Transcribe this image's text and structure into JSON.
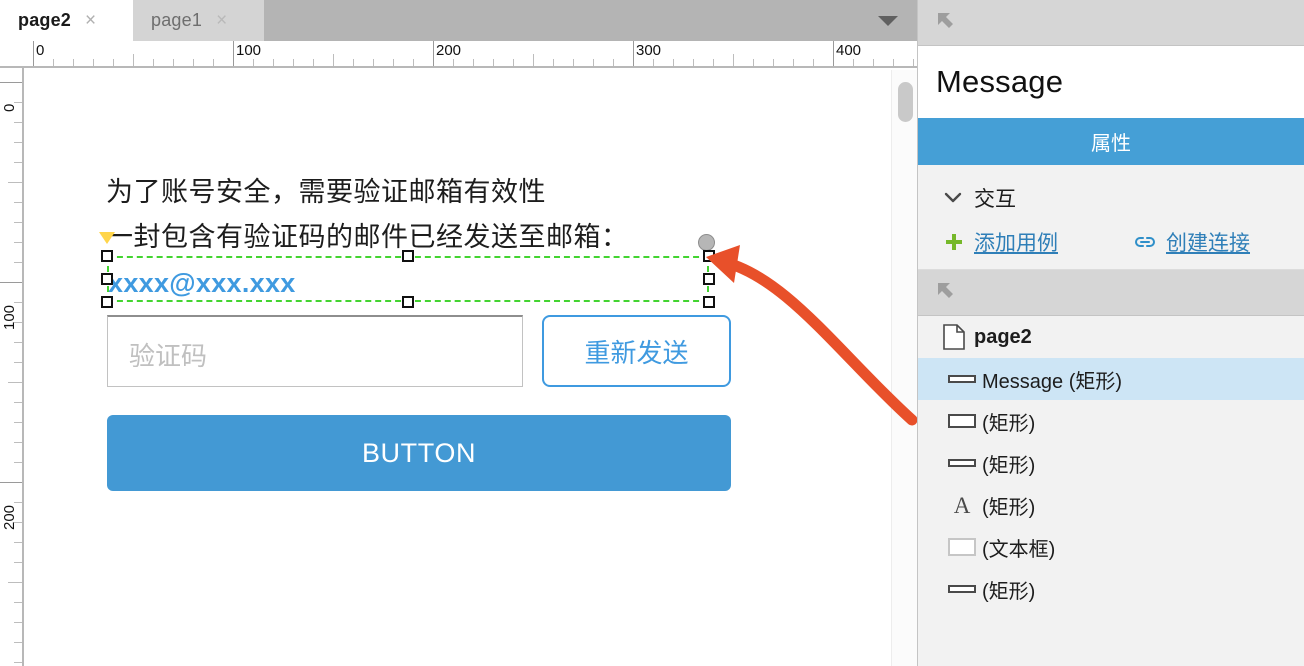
{
  "tabs": [
    {
      "label": "page2",
      "close": "×",
      "active": true
    },
    {
      "label": "page1",
      "close": "×",
      "active": false
    }
  ],
  "tab_dropdown_icon": "chevron-down-icon",
  "rulers": {
    "horizontal_labels": [
      "0",
      "100",
      "200",
      "300",
      "400"
    ],
    "vertical_labels": [
      "0",
      "100",
      "200"
    ]
  },
  "canvas": {
    "line1": "为了账号安全，需要验证邮箱有效性",
    "line2": "一封包含有验证码的邮件已经发送至邮箱：",
    "email": "xxxx@xxx.xxx",
    "input_placeholder": "验证码",
    "resend_label": "重新发送",
    "primary_button_label": "BUTTON"
  },
  "right_panel": {
    "title": "Message",
    "properties_header": "属性",
    "interaction_label": "交互",
    "actions": [
      {
        "icon": "plus-icon",
        "label": "添加用例"
      },
      {
        "icon": "link-icon",
        "label": "创建连接"
      }
    ]
  },
  "tree": {
    "root": {
      "icon": "page-icon",
      "label": "page2"
    },
    "items": [
      {
        "icon": "rect-thin-icon",
        "label": "Message (矩形)",
        "selected": true
      },
      {
        "icon": "rect-tall-icon",
        "label": "(矩形)",
        "selected": false
      },
      {
        "icon": "rect-thin-icon",
        "label": "(矩形)",
        "selected": false
      },
      {
        "icon": "text-a-icon",
        "label": "(矩形)",
        "selected": false
      },
      {
        "icon": "textbox-icon",
        "label": "(文本框)",
        "selected": false
      },
      {
        "icon": "rect-thin-icon",
        "label": "(矩形)",
        "selected": false
      }
    ]
  },
  "colors": {
    "accent_blue": "#459fd6",
    "button_blue": "#4399d4",
    "selection_green": "#43d430",
    "annotation_orange": "#e8502a",
    "tree_selected_bg": "#cde5f5",
    "link_blue": "#2f7fb8",
    "plus_green": "#76b82a"
  }
}
